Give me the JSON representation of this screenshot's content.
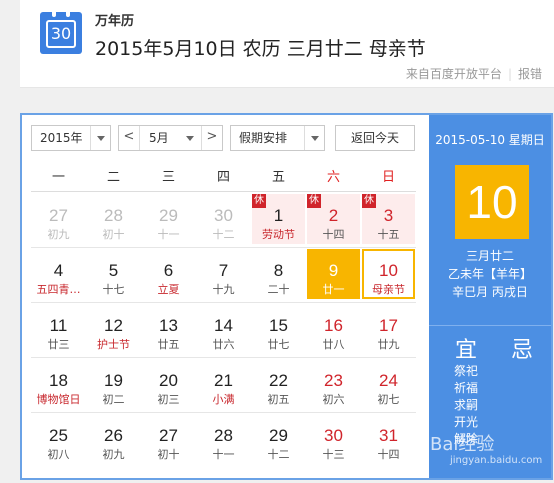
{
  "header": {
    "app_name": "万年历",
    "date_line": "2015年5月10日 农历 三月廿二 母亲节",
    "source": "来自百度开放平台",
    "report": "报错",
    "icon_number": "30"
  },
  "toolbar": {
    "year": "2015年",
    "month": "5月",
    "prev": "<",
    "next": ">",
    "holiday": "假期安排",
    "today_btn": "返回今天"
  },
  "weekdays": [
    "一",
    "二",
    "三",
    "四",
    "五",
    "六",
    "日"
  ],
  "calendar": {
    "rows": [
      [
        {
          "d": "27",
          "l": "初九",
          "type": "other"
        },
        {
          "d": "28",
          "l": "初十",
          "type": "other"
        },
        {
          "d": "29",
          "l": "十一",
          "type": "other"
        },
        {
          "d": "30",
          "l": "十二",
          "type": "other"
        },
        {
          "d": "1",
          "l": "劳动节",
          "type": "holiday",
          "xiu": "休",
          "fest": true
        },
        {
          "d": "2",
          "l": "十四",
          "type": "holiday",
          "xiu": "休",
          "wkend": true
        },
        {
          "d": "3",
          "l": "十五",
          "type": "holiday",
          "xiu": "休",
          "wkend": true
        }
      ],
      [
        {
          "d": "4",
          "l": "五四青…",
          "fest": true
        },
        {
          "d": "5",
          "l": "十七"
        },
        {
          "d": "6",
          "l": "立夏",
          "fest": true
        },
        {
          "d": "7",
          "l": "十九"
        },
        {
          "d": "8",
          "l": "二十"
        },
        {
          "d": "9",
          "l": "廿一",
          "type": "selected"
        },
        {
          "d": "10",
          "l": "母亲节",
          "type": "today",
          "fest": true
        }
      ],
      [
        {
          "d": "11",
          "l": "廿三"
        },
        {
          "d": "12",
          "l": "护士节",
          "fest": true
        },
        {
          "d": "13",
          "l": "廿五"
        },
        {
          "d": "14",
          "l": "廿六"
        },
        {
          "d": "15",
          "l": "廿七"
        },
        {
          "d": "16",
          "l": "廿八",
          "wkend": true
        },
        {
          "d": "17",
          "l": "廿九",
          "wkend": true
        }
      ],
      [
        {
          "d": "18",
          "l": "博物馆日",
          "fest": true
        },
        {
          "d": "19",
          "l": "初二"
        },
        {
          "d": "20",
          "l": "初三"
        },
        {
          "d": "21",
          "l": "小满",
          "fest": true
        },
        {
          "d": "22",
          "l": "初五"
        },
        {
          "d": "23",
          "l": "初六",
          "wkend": true
        },
        {
          "d": "24",
          "l": "初七",
          "wkend": true
        }
      ],
      [
        {
          "d": "25",
          "l": "初八"
        },
        {
          "d": "26",
          "l": "初九"
        },
        {
          "d": "27",
          "l": "初十"
        },
        {
          "d": "28",
          "l": "十一"
        },
        {
          "d": "29",
          "l": "十二"
        },
        {
          "d": "30",
          "l": "十三",
          "wkend": true
        },
        {
          "d": "31",
          "l": "十四",
          "wkend": true
        }
      ]
    ]
  },
  "side": {
    "date": "2015-05-10 星期日",
    "day": "10",
    "lunar1": "三月廿二",
    "lunar2": "乙未年【羊年】",
    "lunar3": "辛巳月 丙戌日",
    "yi": "宜",
    "ji": "忌",
    "yi_items": [
      "祭祀",
      "祈福",
      "求嗣",
      "开光",
      "解除"
    ]
  },
  "watermark": {
    "text": "Bai经验",
    "url": "jingyan.baidu.com"
  },
  "colors": {
    "accent": "#4c8fe3",
    "highlight": "#f8b500",
    "red": "#d0242b"
  }
}
